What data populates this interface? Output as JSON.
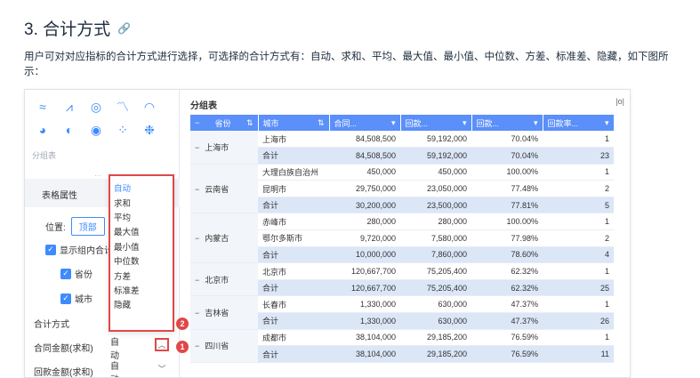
{
  "heading": {
    "title": "3. 合计方式",
    "link_icon": "link-icon"
  },
  "description": "用户可对对应指标的合计方式进行选择，可选择的合计方式有：自动、求和、平均、最大值、最小值、中位数、方差、标准差、隐藏，如下图所示：",
  "left_panel": {
    "chart_icons": [
      "≈",
      "⩘",
      "◎",
      "〽",
      "◠",
      "◕",
      "◐",
      "◉",
      "⁘",
      "❉"
    ],
    "group_label": "分组表",
    "drag_handle": "⋯",
    "tab_label": "表格属性",
    "position_label": "位置:",
    "position_value": "顶部",
    "show_subtotal_label": "显示组内合计",
    "check_province": "省份",
    "check_city": "城市",
    "sum_method_label": "合计方式",
    "field1_label": "合同金额(求和)",
    "field1_value": "自动",
    "field2_label": "回款金额(求和)",
    "field2_value": "自动",
    "dropdown_options": [
      "自动",
      "求和",
      "平均",
      "最大值",
      "最小值",
      "中位数",
      "方差",
      "标准差",
      "隐藏"
    ],
    "badge_1": "1",
    "badge_2": "2"
  },
  "table": {
    "title": "分组表",
    "tool_icon": "|o|",
    "headers": [
      "省份",
      "城市",
      "合同...",
      "回款...",
      "回款...",
      "回款率..."
    ],
    "groups": [
      {
        "province": "上海市",
        "rows": [
          [
            "上海市",
            "84,508,500",
            "59,192,000",
            "70.04%",
            "1"
          ],
          [
            "合计",
            "84,508,500",
            "59,192,000",
            "70.04%",
            "23"
          ]
        ]
      },
      {
        "province": "云南省",
        "rows": [
          [
            "大理白族自治州",
            "450,000",
            "450,000",
            "100.00%",
            "1"
          ],
          [
            "昆明市",
            "29,750,000",
            "23,050,000",
            "77.48%",
            "2"
          ],
          [
            "合计",
            "30,200,000",
            "23,500,000",
            "77.81%",
            "5"
          ]
        ]
      },
      {
        "province": "内蒙古",
        "rows": [
          [
            "赤峰市",
            "280,000",
            "280,000",
            "100.00%",
            "1"
          ],
          [
            "鄂尔多斯市",
            "9,720,000",
            "7,580,000",
            "77.98%",
            "2"
          ],
          [
            "合计",
            "10,000,000",
            "7,860,000",
            "78.60%",
            "4"
          ]
        ]
      },
      {
        "province": "北京市",
        "rows": [
          [
            "北京市",
            "120,667,700",
            "75,205,400",
            "62.32%",
            "1"
          ],
          [
            "合计",
            "120,667,700",
            "75,205,400",
            "62.32%",
            "25"
          ]
        ]
      },
      {
        "province": "吉林省",
        "rows": [
          [
            "长春市",
            "1,330,000",
            "630,000",
            "47.37%",
            "1"
          ],
          [
            "合计",
            "1,330,000",
            "630,000",
            "47.37%",
            "26"
          ]
        ]
      },
      {
        "province": "四川省",
        "rows": [
          [
            "成都市",
            "38,104,000",
            "29,185,200",
            "76.59%",
            "1"
          ],
          [
            "合计",
            "38,104,000",
            "29,185,200",
            "76.59%",
            "11"
          ]
        ]
      }
    ]
  }
}
